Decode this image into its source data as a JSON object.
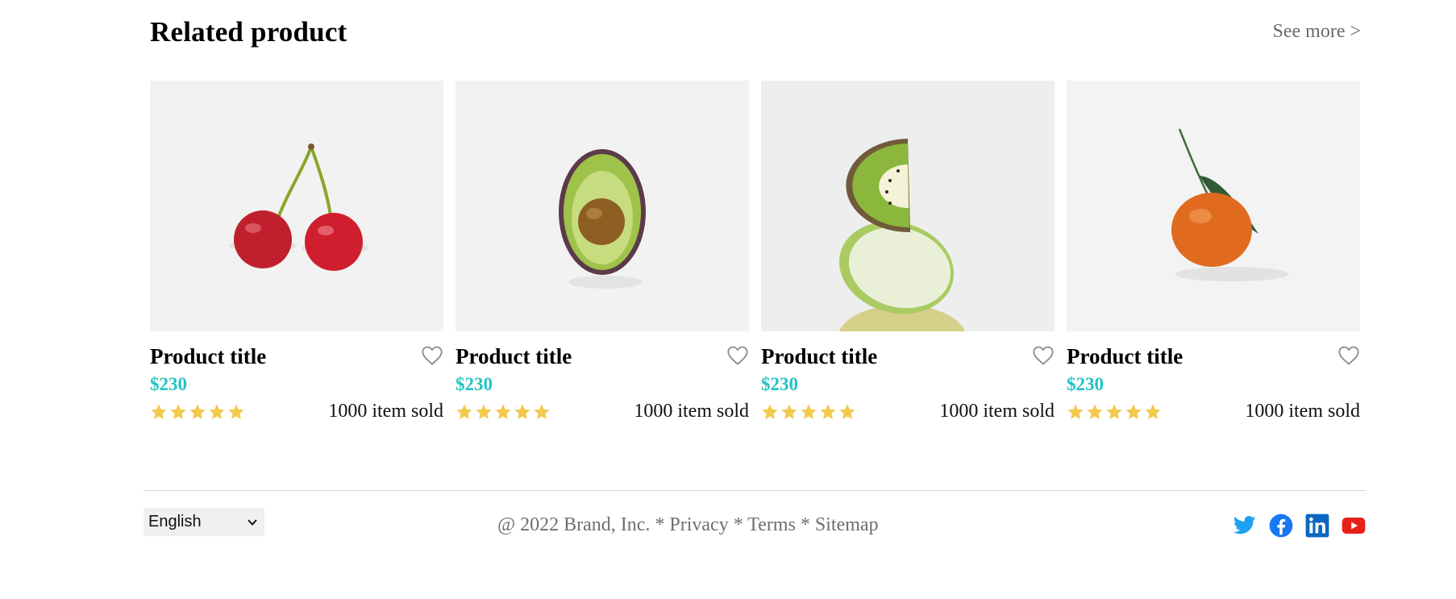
{
  "section": {
    "title": "Related product",
    "see_more": "See more >"
  },
  "products": [
    {
      "title": "Product title",
      "price": "$230",
      "rating": 5,
      "sold": "1000 item sold",
      "image": "cherries"
    },
    {
      "title": "Product title",
      "price": "$230",
      "rating": 5,
      "sold": "1000 item sold",
      "image": "avocado"
    },
    {
      "title": "Product title",
      "price": "$230",
      "rating": 5,
      "sold": "1000 item sold",
      "image": "kiwi-lime-stack"
    },
    {
      "title": "Product title",
      "price": "$230",
      "rating": 5,
      "sold": "1000 item sold",
      "image": "tangerine"
    }
  ],
  "footer": {
    "language": "English",
    "copyright": "@ 2022 Brand, Inc. * Privacy * Terms * Sitemap",
    "socials": [
      "twitter-icon",
      "facebook-icon",
      "linkedin-icon",
      "youtube-icon"
    ]
  },
  "colors": {
    "price": "#22c4c4",
    "star": "#f2c94c",
    "twitter": "#1da1f2",
    "facebook": "#1877f2",
    "linkedin": "#0a66c2",
    "youtube": "#e62117"
  }
}
